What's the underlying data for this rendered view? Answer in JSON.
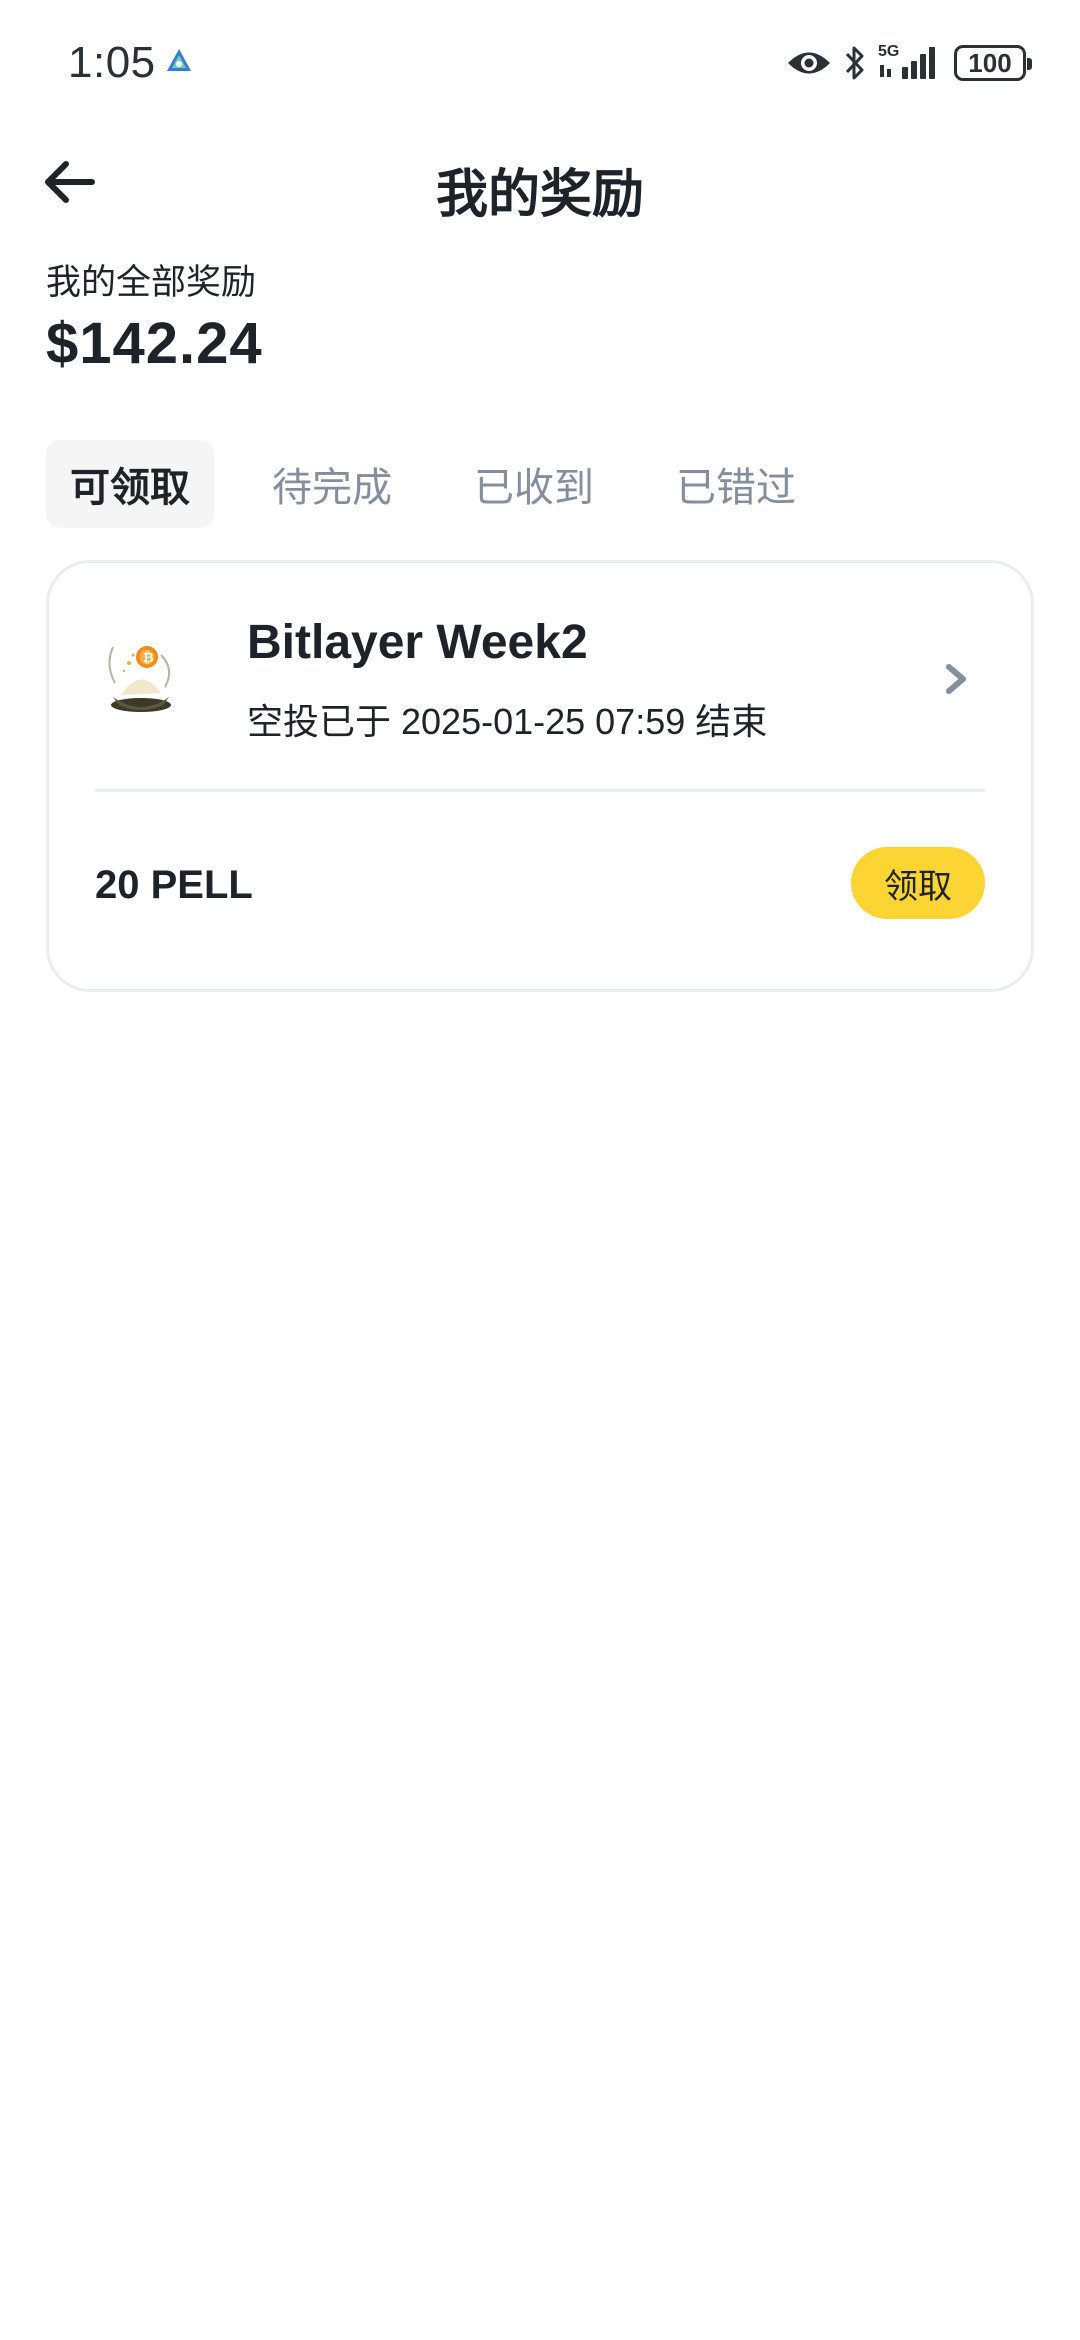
{
  "status_bar": {
    "time": "1:05",
    "network": "5G",
    "battery": "100",
    "icons": [
      "app-notification-icon",
      "eye-icon",
      "bluetooth-icon",
      "signal-icon",
      "battery-icon"
    ]
  },
  "header": {
    "title": "我的奖励",
    "back_icon": "back-arrow-icon"
  },
  "summary": {
    "label": "我的全部奖励",
    "amount": "$142.24"
  },
  "tabs": [
    {
      "label": "可领取",
      "active": true
    },
    {
      "label": "待完成",
      "active": false
    },
    {
      "label": "已收到",
      "active": false
    },
    {
      "label": "已错过",
      "active": false
    }
  ],
  "rewards": [
    {
      "project": "Bitlayer Week2",
      "status_text": "空投已于 2025-01-25 07:59 结束",
      "amount": "20 PELL",
      "action_label": "领取",
      "logo_icon": "bitlayer-logo-icon"
    }
  ],
  "colors": {
    "accent": "#fcd535",
    "text_primary": "#1e2329",
    "text_secondary": "#848e9c",
    "tab_active_bg": "#f5f5f5",
    "border": "#eaecef"
  }
}
